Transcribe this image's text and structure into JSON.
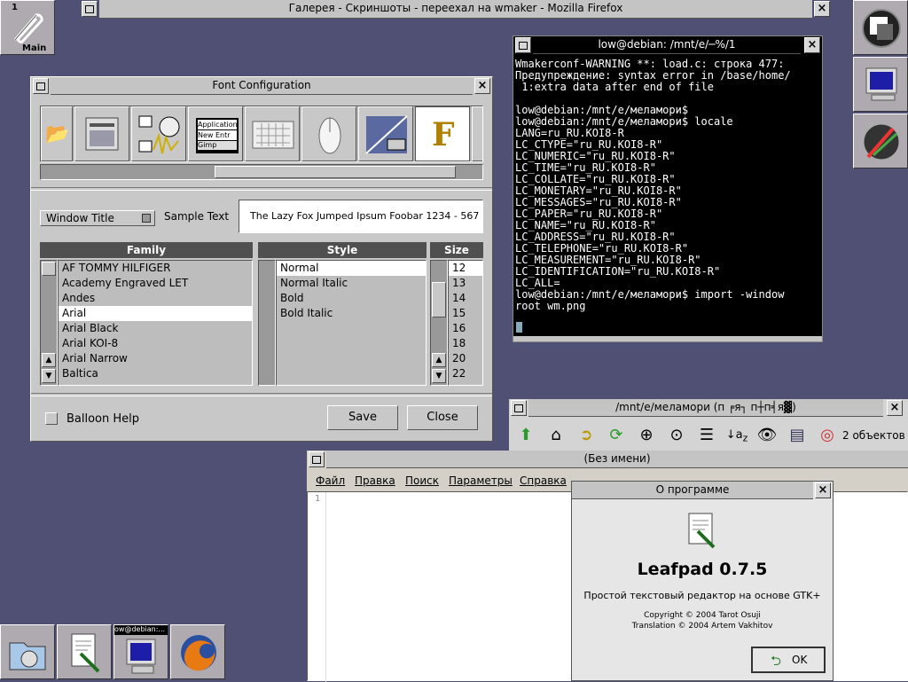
{
  "dock_clip": {
    "number": "1",
    "label": "Main"
  },
  "firefox_window": {
    "title": "Галерея - Скриншоты - переехал на wmaker - Mozilla Firefox"
  },
  "font_config": {
    "title": "Font Configuration",
    "select_value": "Window Title",
    "sample_label": "Sample Text",
    "sample_text": "The Lazy Fox Jumped Ipsum Foobar 1234 - 567",
    "icons": [
      "Application",
      "New Entr",
      "Gimp"
    ],
    "family_header": "Family",
    "style_header": "Style",
    "size_header": "Size",
    "families": [
      "AF TOMMY HILFIGER",
      "Academy Engraved LET",
      "Andes",
      "Arial",
      "Arial Black",
      "Arial KOI-8",
      "Arial Narrow",
      "Baltica"
    ],
    "selected_family": "Arial",
    "styles": [
      "Normal",
      "Normal Italic",
      "Bold",
      "Bold Italic"
    ],
    "sizes": [
      "12",
      "13",
      "14",
      "15",
      "16",
      "18",
      "20",
      "22"
    ],
    "balloon_help": "Balloon Help",
    "save": "Save",
    "close": "Close"
  },
  "terminal": {
    "title": "low@debian: /mnt/e/─%/1",
    "lines": [
      "Wmakerconf-WARNING **: load.c: строка 477:",
      "Предупреждение: syntax error in /base/home/",
      " 1:extra data after end of file",
      "",
      "low@debian:/mnt/e/меламори$",
      "low@debian:/mnt/e/меламори$ locale",
      "LANG=ru_RU.KOI8-R",
      "LC_CTYPE=\"ru_RU.KOI8-R\"",
      "LC_NUMERIC=\"ru_RU.KOI8-R\"",
      "LC_TIME=\"ru_RU.KOI8-R\"",
      "LC_COLLATE=\"ru_RU.KOI8-R\"",
      "LC_MONETARY=\"ru_RU.KOI8-R\"",
      "LC_MESSAGES=\"ru_RU.KOI8-R\"",
      "LC_PAPER=\"ru_RU.KOI8-R\"",
      "LC_NAME=\"ru_RU.KOI8-R\"",
      "LC_ADDRESS=\"ru_RU.KOI8-R\"",
      "LC_TELEPHONE=\"ru_RU.KOI8-R\"",
      "LC_MEASUREMENT=\"ru_RU.KOI8-R\"",
      "LC_IDENTIFICATION=\"ru_RU.KOI8-R\"",
      "LC_ALL=",
      "low@debian:/mnt/e/меламори$ import -window",
      "root wm.png"
    ]
  },
  "filemanager": {
    "title": "/mnt/e/меламори (п ╒я┐ п┼п╡я▓)",
    "status": "2 объектов"
  },
  "leafpad": {
    "title": "(Без имени)",
    "menu": [
      "Файл",
      "Правка",
      "Поиск",
      "Параметры",
      "Справка"
    ],
    "line_number": "1"
  },
  "about": {
    "title": "О программе",
    "app_name": "Leafpad 0.7.5",
    "description": "Простой текстовый редактор на основе GTK+",
    "copyright": "Copyright © 2004 Tarot Osuji",
    "translation": "Translation © 2004 Artem Vakhitov",
    "ok": "OK"
  },
  "taskbar": {
    "terminal_label": "ow@debian:..."
  }
}
